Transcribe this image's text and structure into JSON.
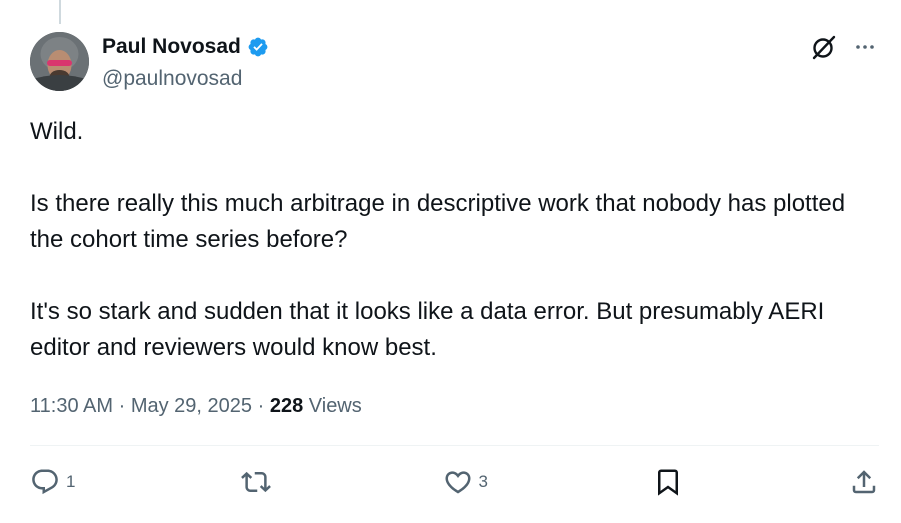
{
  "author": {
    "display_name": "Paul Novosad",
    "handle": "@paulnovosad",
    "verified": true
  },
  "tweet": {
    "paragraphs": [
      "Wild.",
      "Is there really this much arbitrage in descriptive work that nobody has plotted the cohort time series before?",
      "It's so stark and sudden that it looks like a data error. But presumably AERI editor and reviewers would know best."
    ]
  },
  "meta": {
    "time": "11:30 AM",
    "separator": "·",
    "date": "May 29, 2025",
    "views_count": "228",
    "views_label": "Views"
  },
  "actions": {
    "reply_count": "1",
    "retweet_count": "",
    "like_count": "3"
  },
  "icons": {
    "top": [
      "grok-icon",
      "more-icon"
    ],
    "bottom": [
      "reply-icon",
      "retweet-icon",
      "like-icon",
      "bookmark-icon",
      "share-icon"
    ]
  },
  "colors": {
    "verified": "#1d9bf0",
    "text": "#0f1419",
    "secondary": "#536471",
    "divider": "#eff3f4"
  }
}
